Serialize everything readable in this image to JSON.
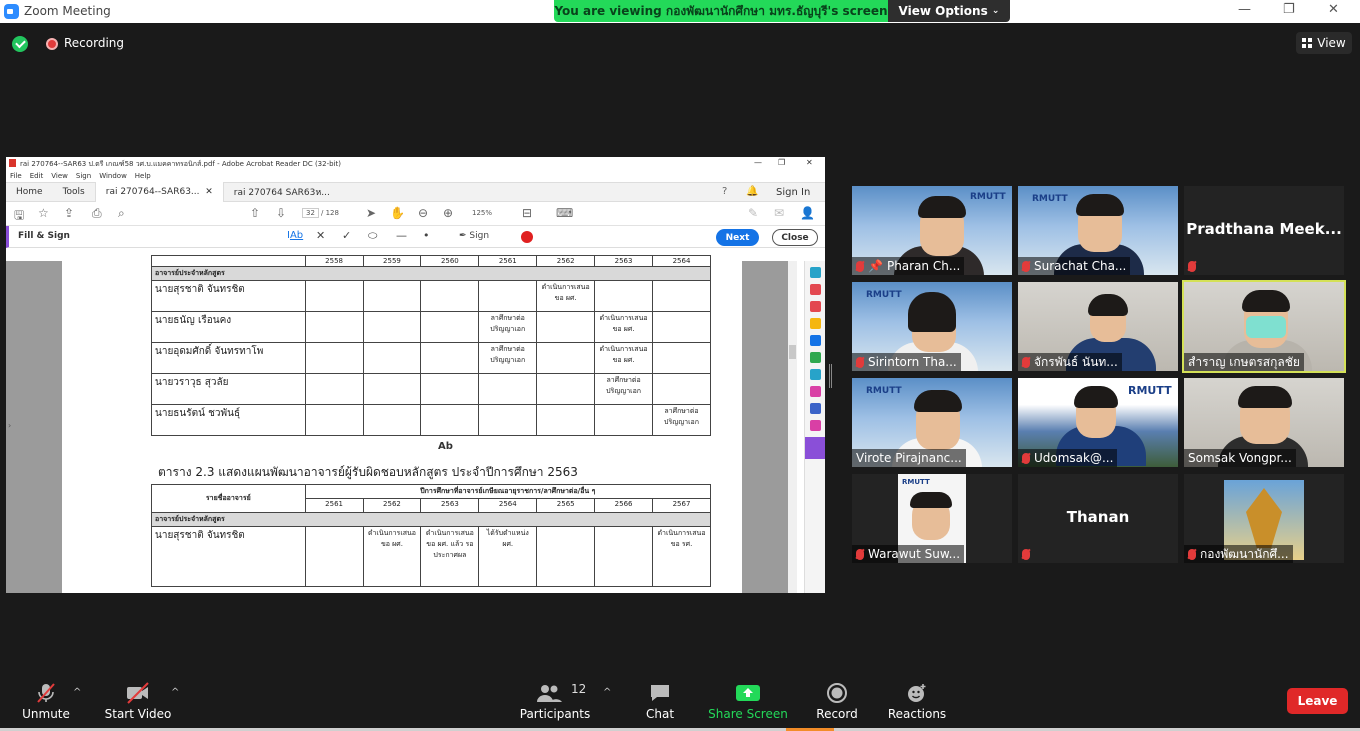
{
  "window": {
    "title": "Zoom Meeting",
    "min": "—",
    "max": "❐",
    "close": "✕"
  },
  "share_banner": {
    "text": "You are viewing กองพัฒนานักศึกษา มทร.ธัญบุรี's screen",
    "view_options": "View Options"
  },
  "top": {
    "recording": "Recording",
    "view": "View"
  },
  "acrobat": {
    "title": "rai 270764--SAR63 ป.ตรี เกณฑ์58 วศ.บ.แมคคาทรอนิกส์.pdf - Adobe Acrobat Reader DC (32-bit)",
    "menu": [
      "File",
      "Edit",
      "View",
      "Sign",
      "Window",
      "Help"
    ],
    "tabs": {
      "home": "Home",
      "tools": "Tools",
      "doc1": "rai 270764--SAR63...",
      "doc2": "rai 270764 SAR63ห..."
    },
    "sign_in": "Sign In",
    "page_current": "32",
    "page_total": "/ 128",
    "zoom": "125%",
    "fill_sign": "Fill & Sign",
    "sign": "Sign",
    "next": "Next",
    "close": "Close",
    "ab_marker": "Ab",
    "table1": {
      "header_years": [
        "2558",
        "2559",
        "2560",
        "2561",
        "2562",
        "2563",
        "2564"
      ],
      "section": "อาจารย์ประจำหลักสูตร",
      "rows": [
        {
          "name": "นายสุรชาติ จันทรชิต",
          "cells": [
            "",
            "",
            "",
            "",
            "ดำเนินการเสนอขอ ผศ.",
            "",
            ""
          ]
        },
        {
          "name": "นายธนัญ เรือนคง",
          "cells": [
            "",
            "",
            "",
            "ลาศึกษาต่อปริญญาเอก",
            "",
            "ดำเนินการเสนอขอ ผศ.",
            ""
          ]
        },
        {
          "name": "นายอุดมศักดิ์ จันทรทาโพ",
          "cells": [
            "",
            "",
            "",
            "ลาศึกษาต่อปริญญาเอก",
            "",
            "ดำเนินการเสนอขอ ผศ.",
            ""
          ]
        },
        {
          "name": "นายวราวุธ สุวลัย",
          "cells": [
            "",
            "",
            "",
            "",
            "",
            "ลาศึกษาต่อปริญญาเอก",
            ""
          ]
        },
        {
          "name": "นายธนรัตน์ ชวพันธุ์",
          "cells": [
            "",
            "",
            "",
            "",
            "",
            "",
            "ลาศึกษาต่อปริญญาเอก"
          ]
        }
      ]
    },
    "caption": "ตาราง 2.3 แสดงแผนพัฒนาอาจารย์ผู้รับผิดชอบหลักสูตร ประจำปีการศึกษา 2563",
    "table2": {
      "name_header": "รายชื่ออาจารย์",
      "group_header": "ปีการศึกษาที่อาจารย์เกษียณอายุราชการ/ลาศึกษาต่อ/อื่น ๆ",
      "years": [
        "2561",
        "2562",
        "2563",
        "2564",
        "2565",
        "2566",
        "2567"
      ],
      "section": "อาจารย์ประจำหลักสูตร",
      "rows": [
        {
          "name": "นายสุรชาติ จันทรชิต",
          "cells": [
            "",
            "ดำเนินการเสนอขอ ผศ.",
            "ดำเนินการเสนอขอ ผศ. แล้ว รอประกาศผล",
            "ได้รับตำแหน่ง ผศ.",
            "",
            "",
            "ดำเนินการเสนอขอ รศ."
          ]
        }
      ]
    }
  },
  "participants": [
    {
      "name": "Pharan Ch...",
      "type": "video"
    },
    {
      "name": "Surachat Cha...",
      "type": "video"
    },
    {
      "name": "Pradthana  Meek...",
      "type": "name"
    },
    {
      "name": "Sirintorn Tha...",
      "type": "video"
    },
    {
      "name": "จักรพันธ์ นันท...",
      "type": "video"
    },
    {
      "name": "สำราญ เกษตรสกุลชัย",
      "type": "video"
    },
    {
      "name": "Virote Pirajnanc...",
      "type": "video"
    },
    {
      "name": "Udomsak@...",
      "type": "video"
    },
    {
      "name": "Somsak Vongpr...",
      "type": "video"
    },
    {
      "name": "Warawut Suw...",
      "type": "video"
    },
    {
      "name": "Thanan",
      "type": "name"
    },
    {
      "name": "กองพัฒนานักศึ...",
      "type": "image"
    }
  ],
  "toolbar": {
    "unmute": "Unmute",
    "start_video": "Start Video",
    "participants": "Participants",
    "participants_count": "12",
    "chat": "Chat",
    "share_screen": "Share Screen",
    "record": "Record",
    "reactions": "Reactions",
    "leave": "Leave"
  },
  "colors": {
    "share_green": "#23d959",
    "leave_red": "#e02828",
    "active_speaker": "#d4e157",
    "acro_blue": "#1473e6"
  }
}
